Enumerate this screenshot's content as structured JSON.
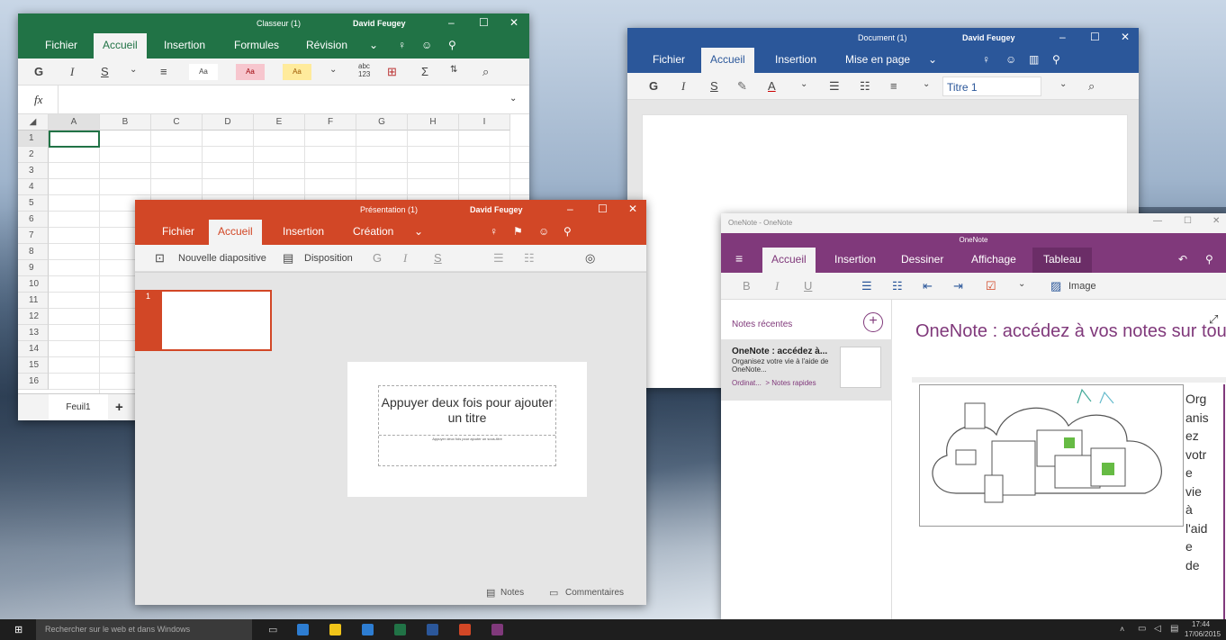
{
  "excel": {
    "title": "Classeur (1)",
    "user": "David Feugey",
    "controls": {
      "minimize": "–",
      "maximize": "☐",
      "close": "✕"
    },
    "tabs": [
      "Fichier",
      "Accueil",
      "Insertion",
      "Formules",
      "Révision"
    ],
    "toolbar": {
      "bold": "G",
      "italic": "I",
      "underline": "S",
      "style1": "Aa",
      "style2": "Aa",
      "style3": "Aa",
      "numfmt": "abc\n123",
      "sum": "Σ"
    },
    "formula_label": "fx",
    "columns": [
      "A",
      "B",
      "C",
      "D",
      "E",
      "F",
      "G",
      "H",
      "I"
    ],
    "rows": [
      "1",
      "2",
      "3",
      "4",
      "5",
      "6",
      "7",
      "8",
      "9",
      "10",
      "11",
      "12",
      "13",
      "14",
      "15",
      "16"
    ],
    "sheet_tab": "Feuil1",
    "add_sheet": "+"
  },
  "word": {
    "title": "Document (1)",
    "user": "David Feugey",
    "controls": {
      "minimize": "–",
      "maximize": "☐",
      "close": "✕"
    },
    "tabs": [
      "Fichier",
      "Accueil",
      "Insertion",
      "Mise en page"
    ],
    "toolbar": {
      "bold": "G",
      "italic": "I",
      "underline": "S",
      "font_color": "A",
      "style": "Titre 1"
    }
  },
  "ppt": {
    "title": "Présentation (1)",
    "user": "David Feugey",
    "controls": {
      "minimize": "–",
      "maximize": "☐",
      "close": "✕"
    },
    "tabs": [
      "Fichier",
      "Accueil",
      "Insertion",
      "Création"
    ],
    "toolbar": {
      "new_slide": "Nouvelle diapositive",
      "layout": "Disposition",
      "bold": "G",
      "italic": "I",
      "underline": "S"
    },
    "thumb_number": "1",
    "slide": {
      "title_placeholder": "Appuyer deux fois pour ajouter un titre",
      "subtitle_placeholder": "Appuyer deux fois pour ajouter un sous-titre"
    },
    "status": {
      "notes": "Notes",
      "comments": "Commentaires"
    }
  },
  "onenote": {
    "window_title": "OneNote - OneNote",
    "app_title": "OneNote",
    "controls": {
      "minimize": "—",
      "maximize": "☐",
      "close": "✕"
    },
    "tabs": [
      "Accueil",
      "Insertion",
      "Dessiner",
      "Affichage",
      "Tableau"
    ],
    "toolbar": {
      "bold": "B",
      "italic": "I",
      "underline": "U",
      "image": "Image"
    },
    "recent_label": "Notes récentes",
    "recent_item": {
      "title": "OneNote : accédez à...",
      "desc": "Organisez votre vie à l'aide de OneNote...",
      "path": "Ordinat...  > Notes rapides"
    },
    "page_title": "OneNote : accédez à vos notes sur tous v",
    "page_text": [
      "Org",
      "anis",
      "ez",
      "votr",
      "e",
      "vie",
      "à",
      "l'aid",
      "e",
      "de"
    ]
  },
  "taskbar": {
    "search": "Rechercher sur le web et dans Windows",
    "time": "17:44",
    "date": "17/06/2015"
  },
  "colors": {
    "excel": "#217346",
    "word": "#2b579a",
    "ppt": "#d24726",
    "onenote": "#80397b"
  }
}
